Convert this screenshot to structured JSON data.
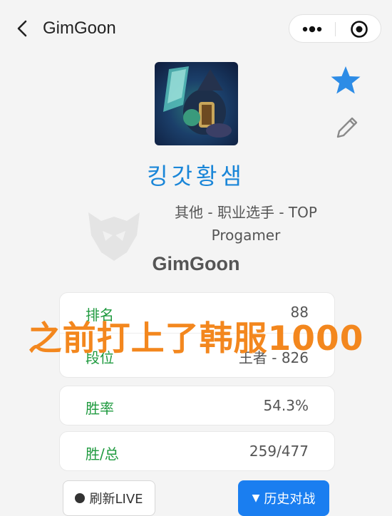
{
  "header": {
    "title": "GimGoon",
    "icons": {
      "back": "chevron-left-icon",
      "more": "more-dots-icon",
      "target": "target-icon"
    }
  },
  "profile": {
    "avatar": "champion-avatar",
    "nickname": "킹갓황샘",
    "role_line1": "其他 - 职业选手 - TOP",
    "role_line2": "Progamer",
    "player_name": "GimGoon",
    "star_color": "#2d8ce6"
  },
  "stats": [
    {
      "label": "排名",
      "value": "88"
    },
    {
      "label": "段位",
      "value": "王者 - 826"
    },
    {
      "label": "胜率",
      "value": "54.3%"
    },
    {
      "label": "胜/总",
      "value": "259/477"
    }
  ],
  "overlay": {
    "text": "之前打上了韩服1000",
    "color": "#f3871e"
  },
  "buttons": {
    "refresh_label": "刷新LIVE",
    "history_label": "历史对战"
  },
  "colors": {
    "accent": "#1a7ef0",
    "label_green": "#1f9a3f",
    "nickname_blue": "#1a86d8"
  }
}
